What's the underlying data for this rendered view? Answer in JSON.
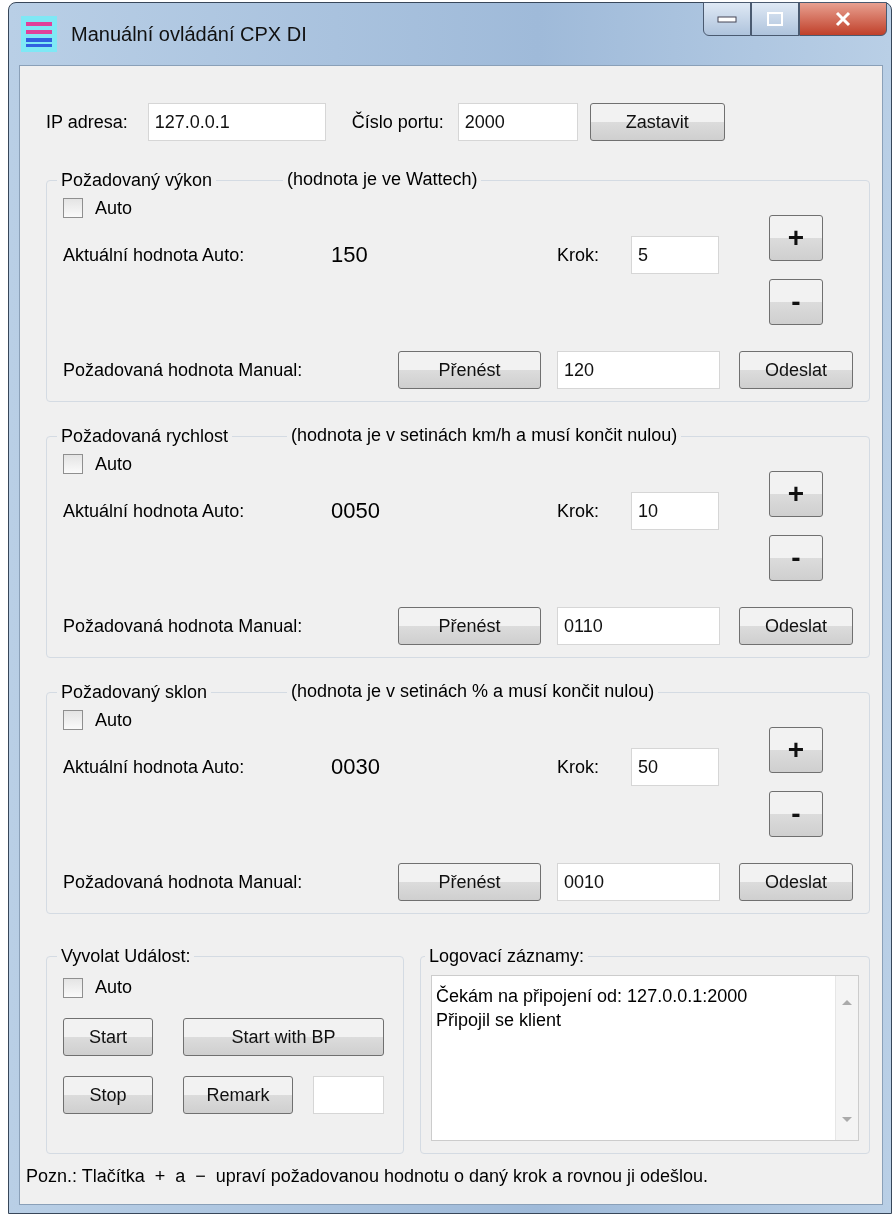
{
  "window": {
    "title": "Manuální ovládání CPX DI"
  },
  "connection": {
    "ip_label": "IP adresa:",
    "ip_value": "127.0.0.1",
    "port_label": "Číslo portu:",
    "port_value": "2000",
    "button": "Zastavit"
  },
  "sections": [
    {
      "title": "Požadovaný výkon",
      "note": "(hodnota je ve Wattech)",
      "auto": {
        "label": "Auto",
        "checked": false
      },
      "current_label": "Aktuální hodnota Auto:",
      "current_value": "150",
      "step_label": "Krok:",
      "step_value": "5",
      "plus": "+",
      "minus": "-",
      "manual_label": "Požadovaná hodnota Manual:",
      "transfer_button": "Přenést",
      "manual_value": "120",
      "send_button": "Odeslat"
    },
    {
      "title": "Požadovaná rychlost",
      "note": "(hodnota je v setinách km/h a musí končit nulou)",
      "auto": {
        "label": "Auto",
        "checked": false
      },
      "current_label": "Aktuální hodnota Auto:",
      "current_value": "0050",
      "step_label": "Krok:",
      "step_value": "10",
      "plus": "+",
      "minus": "-",
      "manual_label": "Požadovaná hodnota Manual:",
      "transfer_button": "Přenést",
      "manual_value": "0110",
      "send_button": "Odeslat"
    },
    {
      "title": "Požadovaný sklon",
      "note": "(hodnota je v setinách % a musí končit nulou)",
      "auto": {
        "label": "Auto",
        "checked": false
      },
      "current_label": "Aktuální hodnota Auto:",
      "current_value": "0030",
      "step_label": "Krok:",
      "step_value": "50",
      "plus": "+",
      "minus": "-",
      "manual_label": "Požadovaná hodnota Manual:",
      "transfer_button": "Přenést",
      "manual_value": "0010",
      "send_button": "Odeslat"
    }
  ],
  "events": {
    "title": "Vyvolat Událost:",
    "auto": {
      "label": "Auto",
      "checked": false
    },
    "buttons": [
      "Start",
      "Start with BP",
      "Stop",
      "Remark"
    ]
  },
  "log": {
    "title": "Logovací záznamy:",
    "lines": [
      "Čekám na připojení od: 127.0.0.1:2000",
      "Připojil se klient"
    ]
  },
  "footnote": "Pozn.: Tlačítka  +  a  −  upraví požadovanou hodnotu o daný krok a rovnou ji odešlou."
}
